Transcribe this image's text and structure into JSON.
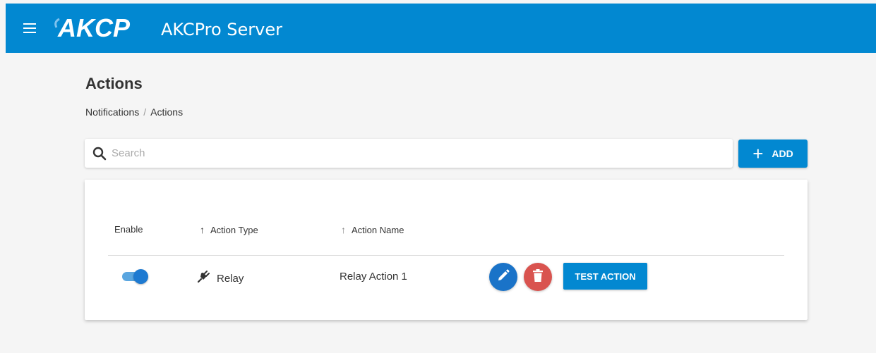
{
  "header": {
    "logo_text": "AKCP",
    "app_title": "AKCPro Server",
    "background_color": "#0288d1"
  },
  "page": {
    "title": "Actions",
    "breadcrumb": [
      "Notifications",
      "Actions"
    ],
    "breadcrumb_separator": "/"
  },
  "search": {
    "placeholder": "Search",
    "value": ""
  },
  "toolbar": {
    "add_label": "ADD",
    "add_icon": "plus-icon"
  },
  "table": {
    "columns": [
      {
        "label": "Enable",
        "sort_icon": null
      },
      {
        "label": "Action Type",
        "sort_icon": "arrow-up-icon"
      },
      {
        "label": "Action Name",
        "sort_icon": "arrow-up-icon"
      }
    ],
    "rows": [
      {
        "enabled": true,
        "action_type": "Relay",
        "action_type_icon": "plug-icon",
        "action_name": "Relay Action 1",
        "edit_icon": "pencil-icon",
        "delete_icon": "trash-icon",
        "test_label": "TEST ACTION"
      }
    ]
  },
  "colors": {
    "primary": "#0288d1",
    "edit": "#1a73c8",
    "delete": "#d9534f",
    "toggle_on": "#1e7ad1"
  }
}
